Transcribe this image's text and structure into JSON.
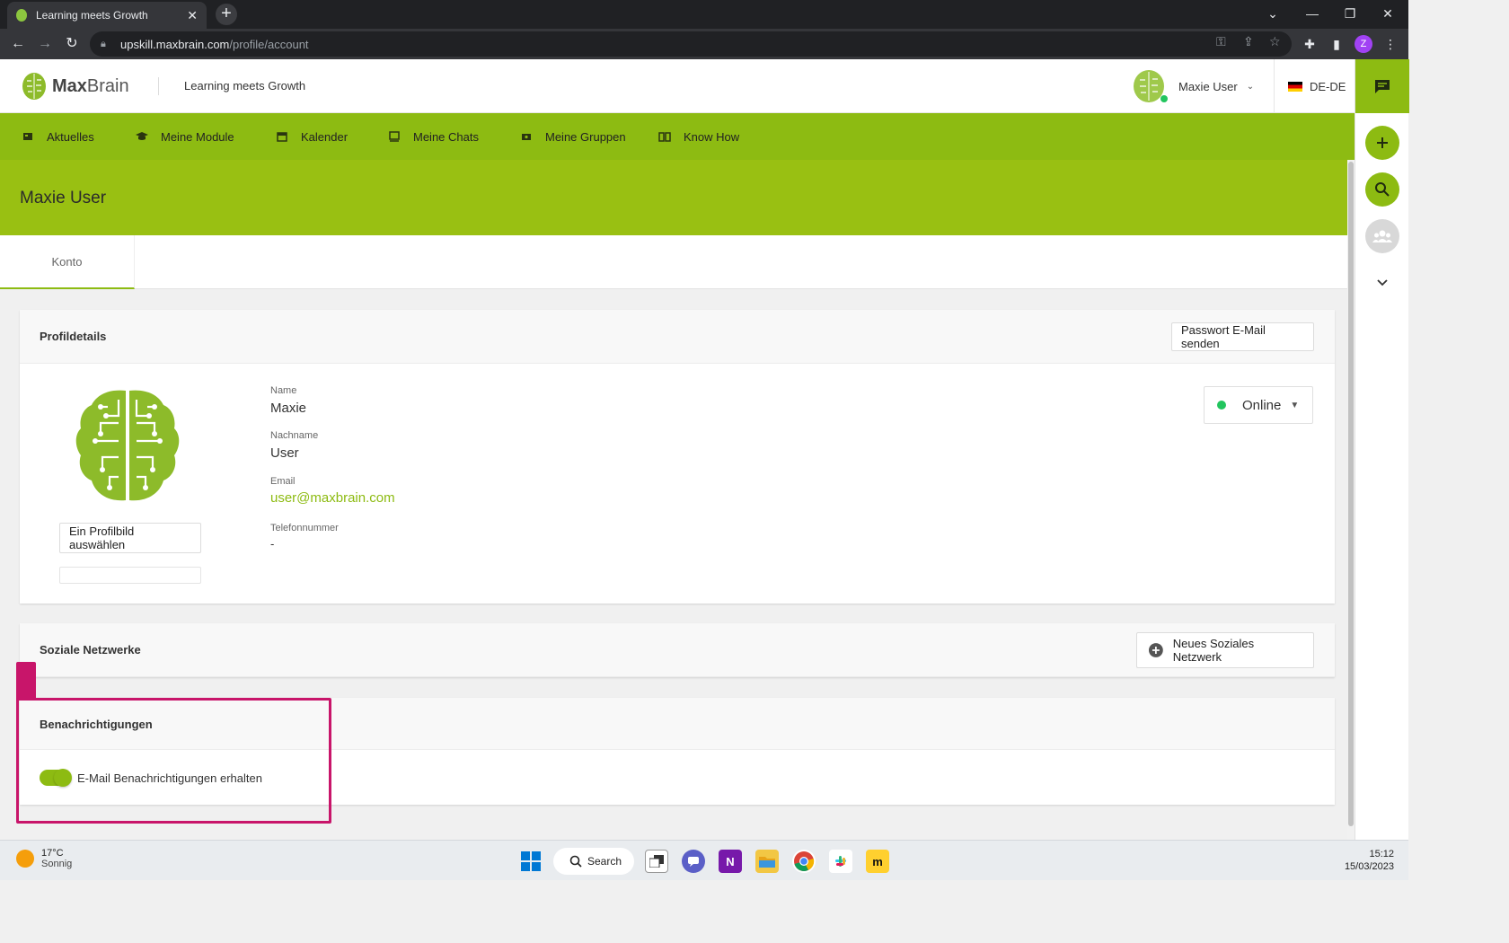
{
  "browser": {
    "tab_title": "Learning meets Growth",
    "url_host": "upskill.maxbrain.com",
    "url_path": "/profile/account",
    "profile_initial": "Z"
  },
  "header": {
    "logo_bold": "Max",
    "logo_regular": "Brain",
    "tagline": "Learning meets Growth",
    "user_name": "Maxie User",
    "language": "DE-DE"
  },
  "nav": {
    "items": [
      {
        "label": "Aktuelles",
        "icon": "news-icon"
      },
      {
        "label": "Meine Module",
        "icon": "graduation-cap-icon"
      },
      {
        "label": "Kalender",
        "icon": "calendar-icon"
      },
      {
        "label": "Meine Chats",
        "icon": "chat-icon"
      },
      {
        "label": "Meine Gruppen",
        "icon": "groups-icon"
      },
      {
        "label": "Know How",
        "icon": "book-icon"
      }
    ]
  },
  "page": {
    "title": "Maxie User",
    "tabs": [
      {
        "label": "Konto"
      }
    ]
  },
  "profile": {
    "section_title": "Profildetails",
    "password_button": "Passwort E-Mail senden",
    "choose_picture_button": "Ein Profilbild auswählen",
    "fields": {
      "name_label": "Name",
      "name_value": "Maxie",
      "lastname_label": "Nachname",
      "lastname_value": "User",
      "email_label": "Email",
      "email_value": "user@maxbrain.com",
      "phone_label": "Telefonnummer",
      "phone_value": "-"
    },
    "status": "Online"
  },
  "social": {
    "section_title": "Soziale Netzwerke",
    "add_button": "Neues Soziales Netzwerk"
  },
  "notifications": {
    "section_title": "Benachrichtigungen",
    "email_toggle_label": "E-Mail Benachrichtigungen erhalten",
    "email_toggle_on": true
  },
  "taskbar": {
    "temperature": "17°C",
    "weather": "Sonnig",
    "search_label": "Search",
    "time": "15:12",
    "date": "15/03/2023"
  },
  "colors": {
    "brand_green": "#8dbb12",
    "title_band": "#99c012",
    "highlight": "#c8156a",
    "online": "#22c55e"
  }
}
